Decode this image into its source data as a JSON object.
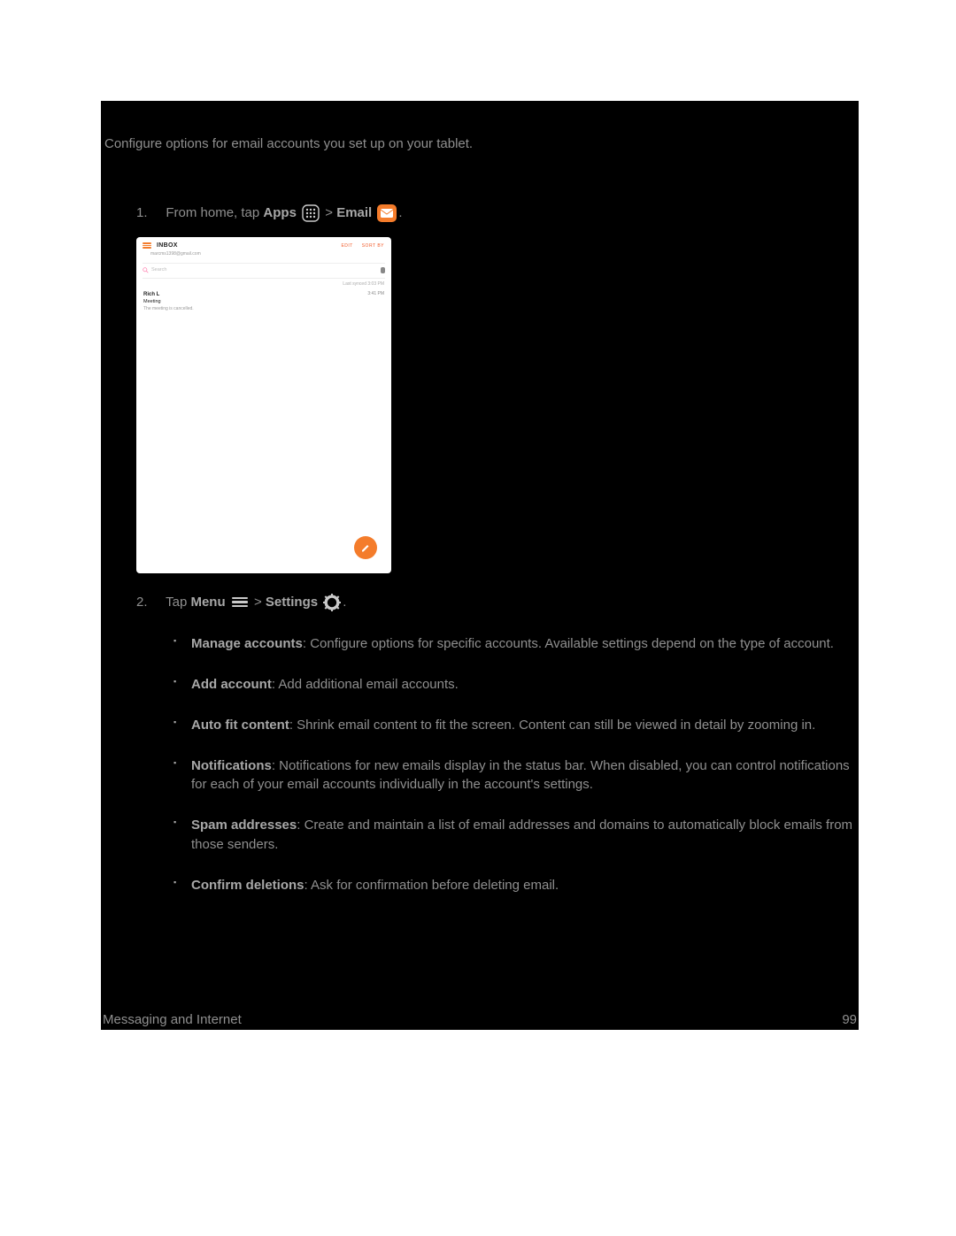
{
  "intro": "Configure options for email accounts you set up on your tablet.",
  "steps": {
    "s1": {
      "num": "1.",
      "t1": "From home, tap ",
      "apps": "Apps",
      "sep": " > ",
      "email": "Email",
      "end": "."
    },
    "s2": {
      "num": "2.",
      "t1": "Tap ",
      "menu": "Menu",
      "sep": " > ",
      "settings": "Settings",
      "end": "."
    }
  },
  "screenshot": {
    "inbox": "INBOX",
    "account": "marcms1398@gmail.com",
    "edit": "EDIT",
    "sort": "SORT BY",
    "search": "Search",
    "lastSync": "Last synced  3:03 PM",
    "item": {
      "name": "Rich L",
      "time": "3:41 PM",
      "subject": "Meeting",
      "snippet": "The meeting is cancelled."
    }
  },
  "bullets": [
    {
      "bold": "Manage accounts",
      "text": ": Configure options for specific accounts. Available settings depend on the type of account."
    },
    {
      "bold": "Add account",
      "text": ": Add additional email accounts."
    },
    {
      "bold": "Auto fit content",
      "text": ": Shrink email content to fit the screen. Content can still be viewed in detail by zooming in."
    },
    {
      "bold": "Notifications",
      "text": ": Notifications for new emails display in the status bar. When disabled, you can control notifications for each of your email accounts individually in the account's settings."
    },
    {
      "bold": "Spam addresses",
      "text": ": Create and maintain a list of email addresses and domains to automatically block emails from those senders."
    },
    {
      "bold": "Confirm deletions",
      "text": ": Ask for confirmation before deleting email."
    }
  ],
  "footer": {
    "section": "Messaging and Internet",
    "page": "99"
  }
}
